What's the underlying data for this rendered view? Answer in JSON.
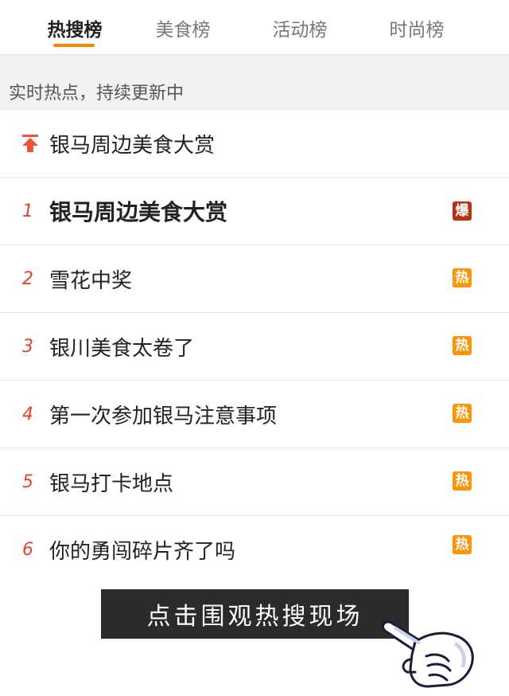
{
  "tabs": [
    {
      "label": "热搜榜",
      "active": true
    },
    {
      "label": "美食榜",
      "active": false
    },
    {
      "label": "活动榜",
      "active": false
    },
    {
      "label": "时尚榜",
      "active": false
    }
  ],
  "accent_color": "#ff8200",
  "subheader": "实时热点，持续更新中",
  "pinned": {
    "title": "银马周边美食大赏",
    "icon": "pin-top-arrow-icon"
  },
  "items": [
    {
      "rank": "1",
      "title": "银马周边美食大赏",
      "badge": "爆",
      "badge_color": "#b8320e"
    },
    {
      "rank": "2",
      "title": "雪花中奖",
      "badge": "热",
      "badge_color": "#ff9406"
    },
    {
      "rank": "3",
      "title": "银川美食太卷了",
      "badge": "热",
      "badge_color": "#ff9406"
    },
    {
      "rank": "4",
      "title": "第一次参加银马注意事项",
      "badge": "热",
      "badge_color": "#ff9406"
    },
    {
      "rank": "5",
      "title": "银马打卡地点",
      "badge": "热",
      "badge_color": "#ff9406"
    },
    {
      "rank": "6",
      "title": "你的勇闯碎片齐了吗",
      "badge": "热",
      "badge_color": "#ff9406"
    }
  ],
  "cta": {
    "label": "点击围观热搜现场",
    "icon": "pointing-hand-icon"
  }
}
